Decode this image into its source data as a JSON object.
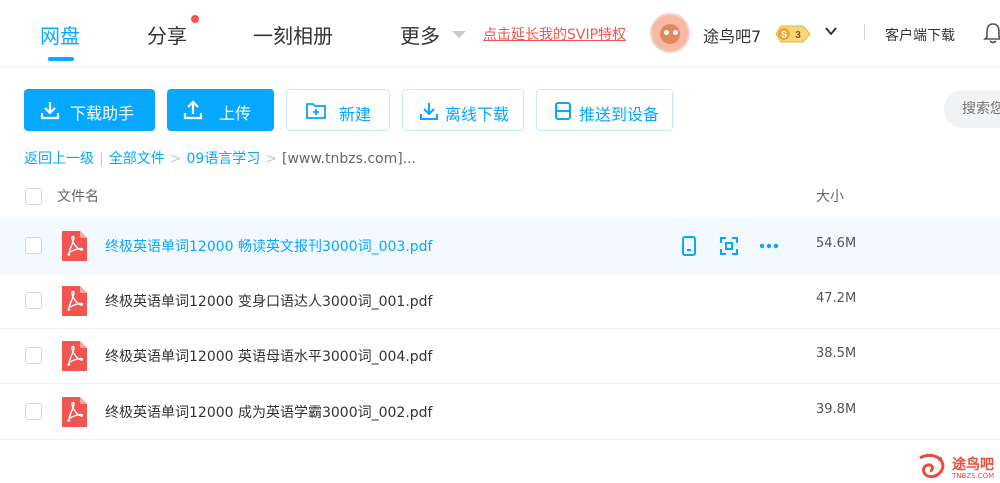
{
  "nav": {
    "items": [
      {
        "label": "网盘",
        "active": true
      },
      {
        "label": "分享",
        "dot": true
      },
      {
        "label": "一刻相册"
      },
      {
        "label": "更多"
      }
    ],
    "promo": "点击延长我的SVIP特权"
  },
  "user": {
    "name": "途鸟吧7",
    "vip_level": "3",
    "vip_letter": "S",
    "client_download": "客户端下载"
  },
  "toolbar": {
    "download_helper": "下载助手",
    "upload": "上传",
    "new_folder": "新建",
    "offline_download": "离线下载",
    "push_device": "推送到设备",
    "search_placeholder": "搜索您的文件"
  },
  "breadcrumb": {
    "back": "返回上一级",
    "all": "全部文件",
    "folder": "09语言学习",
    "current": "[www.tnbzs.com]..."
  },
  "table": {
    "col_name": "文件名",
    "col_size": "大小",
    "rows": [
      {
        "name": "终极英语单词12000 畅读英文报刊3000词_003.pdf",
        "size": "54.6M",
        "hover": true
      },
      {
        "name": "终极英语单词12000 变身口语达人3000词_001.pdf",
        "size": "47.2M"
      },
      {
        "name": "终极英语单词12000 英语母语水平3000词_004.pdf",
        "size": "38.5M"
      },
      {
        "name": "终极英语单词12000 成为英语学霸3000词_002.pdf",
        "size": "39.8M"
      }
    ]
  },
  "watermark": {
    "text": "途鸟吧",
    "sub": "TNBZS.COM"
  },
  "colors": {
    "accent": "#06a7ff",
    "promo": "#f0554f",
    "pdf": "#f0554f"
  }
}
